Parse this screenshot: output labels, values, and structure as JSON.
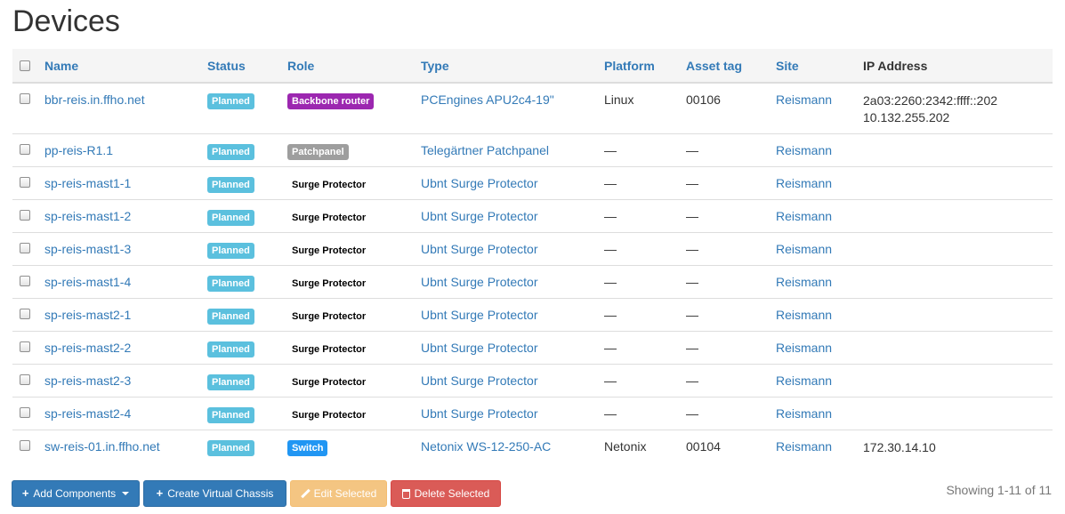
{
  "page": {
    "title": "Devices"
  },
  "table": {
    "columns": [
      "Name",
      "Status",
      "Role",
      "Type",
      "Platform",
      "Asset tag",
      "Site",
      "IP Address"
    ],
    "rows": [
      {
        "name": "bbr-reis.in.ffho.net",
        "status": "Planned",
        "role": "Backbone router",
        "role_color": "#9c27b0",
        "type": "PCEngines APU2c4-19\"",
        "platform": "Linux",
        "asset_tag": "00106",
        "site": "Reismann",
        "ip1": "2a03:2260:2342:ffff::202",
        "ip2": "10.132.255.202"
      },
      {
        "name": "pp-reis-R1.1",
        "status": "Planned",
        "role": "Patchpanel",
        "role_color": "#9e9e9e",
        "type": "Telegärtner Patchpanel",
        "platform": "—",
        "asset_tag": "—",
        "site": "Reismann",
        "ip1": "",
        "ip2": ""
      },
      {
        "name": "sp-reis-mast1-1",
        "status": "Planned",
        "role": "Surge Protector",
        "role_color": "#ffffff",
        "type": "Ubnt Surge Protector",
        "platform": "—",
        "asset_tag": "—",
        "site": "Reismann",
        "ip1": "",
        "ip2": ""
      },
      {
        "name": "sp-reis-mast1-2",
        "status": "Planned",
        "role": "Surge Protector",
        "role_color": "#ffffff",
        "type": "Ubnt Surge Protector",
        "platform": "—",
        "asset_tag": "—",
        "site": "Reismann",
        "ip1": "",
        "ip2": ""
      },
      {
        "name": "sp-reis-mast1-3",
        "status": "Planned",
        "role": "Surge Protector",
        "role_color": "#ffffff",
        "type": "Ubnt Surge Protector",
        "platform": "—",
        "asset_tag": "—",
        "site": "Reismann",
        "ip1": "",
        "ip2": ""
      },
      {
        "name": "sp-reis-mast1-4",
        "status": "Planned",
        "role": "Surge Protector",
        "role_color": "#ffffff",
        "type": "Ubnt Surge Protector",
        "platform": "—",
        "asset_tag": "—",
        "site": "Reismann",
        "ip1": "",
        "ip2": ""
      },
      {
        "name": "sp-reis-mast2-1",
        "status": "Planned",
        "role": "Surge Protector",
        "role_color": "#ffffff",
        "type": "Ubnt Surge Protector",
        "platform": "—",
        "asset_tag": "—",
        "site": "Reismann",
        "ip1": "",
        "ip2": ""
      },
      {
        "name": "sp-reis-mast2-2",
        "status": "Planned",
        "role": "Surge Protector",
        "role_color": "#ffffff",
        "type": "Ubnt Surge Protector",
        "platform": "—",
        "asset_tag": "—",
        "site": "Reismann",
        "ip1": "",
        "ip2": ""
      },
      {
        "name": "sp-reis-mast2-3",
        "status": "Planned",
        "role": "Surge Protector",
        "role_color": "#ffffff",
        "type": "Ubnt Surge Protector",
        "platform": "—",
        "asset_tag": "—",
        "site": "Reismann",
        "ip1": "",
        "ip2": ""
      },
      {
        "name": "sp-reis-mast2-4",
        "status": "Planned",
        "role": "Surge Protector",
        "role_color": "#ffffff",
        "type": "Ubnt Surge Protector",
        "platform": "—",
        "asset_tag": "—",
        "site": "Reismann",
        "ip1": "",
        "ip2": ""
      },
      {
        "name": "sw-reis-01.in.ffho.net",
        "status": "Planned",
        "role": "Switch",
        "role_color": "#2196f3",
        "type": "Netonix WS-12-250-AC",
        "platform": "Netonix",
        "asset_tag": "00104",
        "site": "Reismann",
        "ip1": "172.30.14.10",
        "ip2": ""
      }
    ]
  },
  "actions": {
    "add_components": "Add Components",
    "create_virtual_chassis": "Create Virtual Chassis",
    "edit_selected": "Edit Selected",
    "delete_selected": "Delete Selected"
  },
  "pagination": {
    "showing": "Showing 1-11 of 11"
  },
  "colors": {
    "link": "#337ab7",
    "planned": "#5bc0de",
    "primary": "#337ab7",
    "warning": "#f0ad4e",
    "danger": "#d9534f"
  },
  "icons": {
    "add": "plus-icon",
    "virtual_chassis": "plus-icon",
    "edit": "pencil-icon",
    "delete": "trash-icon",
    "dropdown": "caret-down-icon"
  }
}
